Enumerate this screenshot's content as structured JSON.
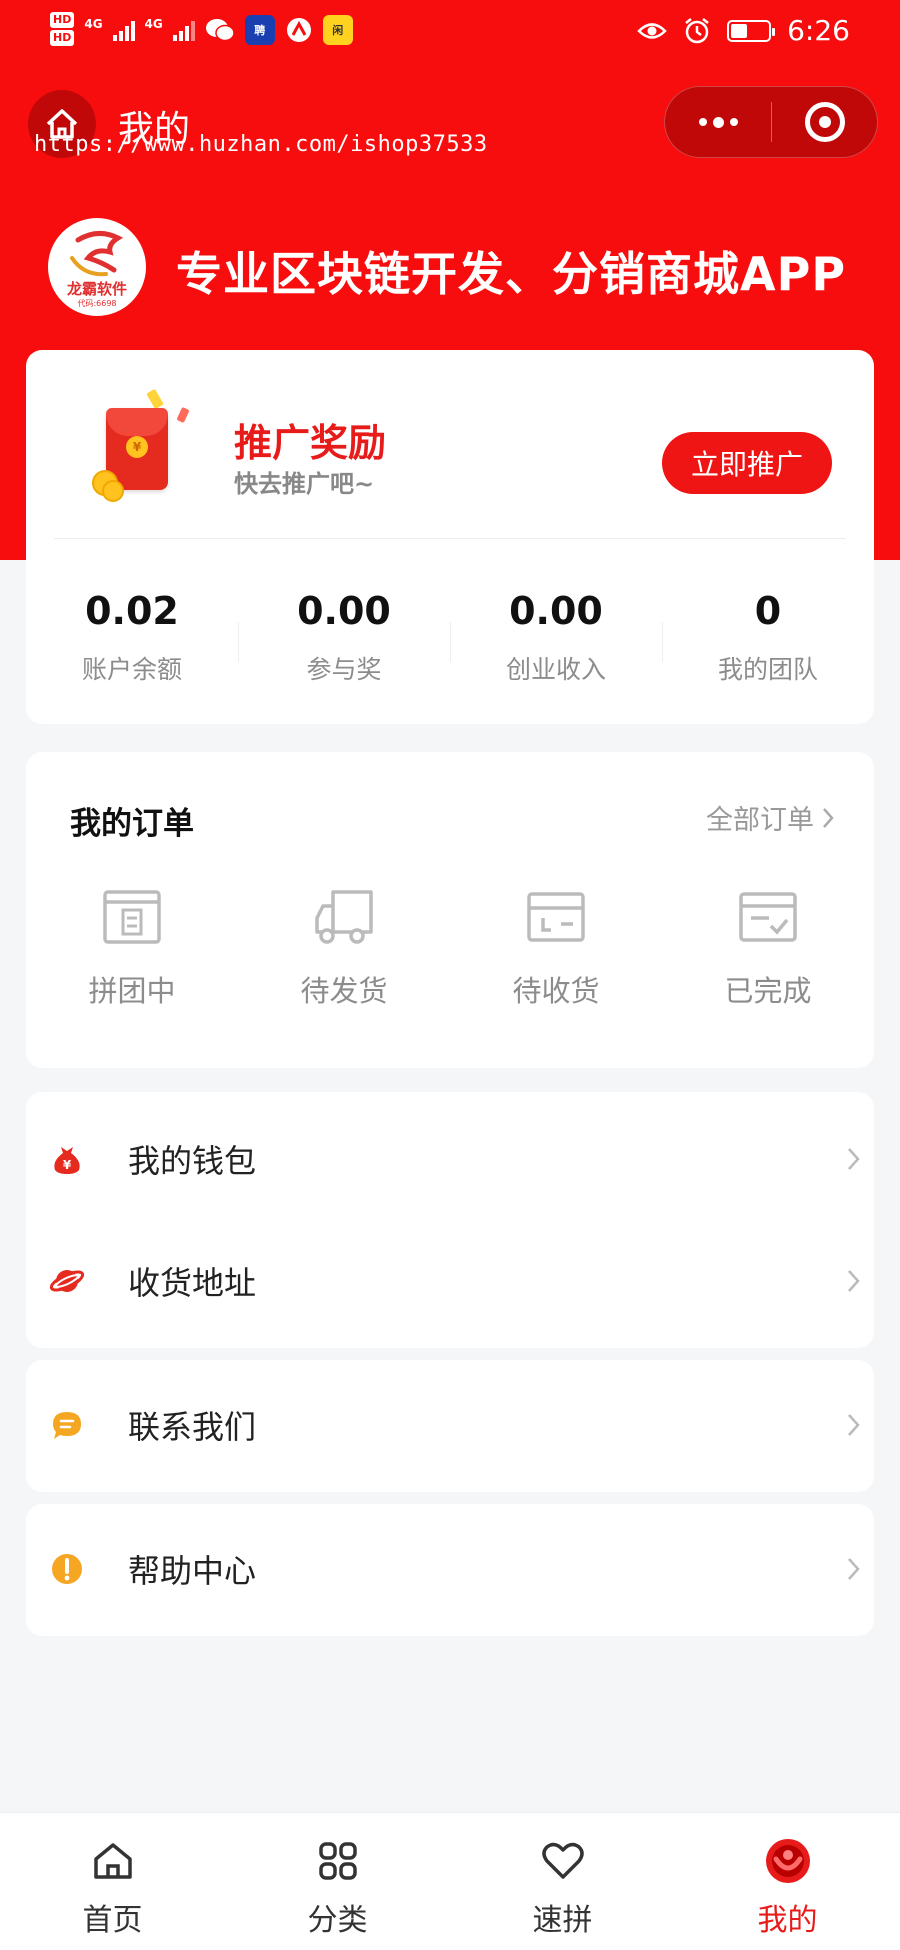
{
  "status_bar": {
    "hd1": "HD",
    "hd2": "HD",
    "net1": "4G",
    "net2": "4G",
    "badge1": "聘",
    "badge2": "闲",
    "time": "6:26"
  },
  "nav": {
    "title": "我的"
  },
  "watermark": "https://www.huzhan.com/ishop37533",
  "brand": {
    "logo_text": "龙霸软件",
    "logo_sub": "代码:6698",
    "tagline": "专业区块链开发、分销商城APP"
  },
  "promo": {
    "title": "推广奖励",
    "subtitle": "快去推广吧~",
    "button": "立即推广",
    "yuan_symbol": "¥",
    "stats": [
      {
        "value": "0.02",
        "label": "账户余额"
      },
      {
        "value": "0.00",
        "label": "参与奖"
      },
      {
        "value": "0.00",
        "label": "创业收入"
      },
      {
        "value": "0",
        "label": "我的团队"
      }
    ]
  },
  "orders": {
    "title": "我的订单",
    "all_link": "全部订单",
    "items": [
      {
        "label": "拼团中",
        "icon": "box-list-icon"
      },
      {
        "label": "待发货",
        "icon": "truck-icon"
      },
      {
        "label": "待收货",
        "icon": "package-icon"
      },
      {
        "label": "已完成",
        "icon": "box-check-icon"
      }
    ]
  },
  "menu": [
    {
      "label": "我的钱包",
      "icon": "money-bag-icon",
      "color": "#e52a1f"
    },
    {
      "label": "收货地址",
      "icon": "planet-icon",
      "color": "#e52a1f"
    },
    {
      "label": "联系我们",
      "icon": "chat-bubble-icon",
      "color": "#f5a623"
    },
    {
      "label": "帮助中心",
      "icon": "exclamation-icon",
      "color": "#f5a623"
    }
  ],
  "tabbar": {
    "items": [
      {
        "label": "首页",
        "icon": "home-icon"
      },
      {
        "label": "分类",
        "icon": "grid-icon"
      },
      {
        "label": "速拼",
        "icon": "heart-icon"
      },
      {
        "label": "我的",
        "icon": "profile-icon"
      }
    ],
    "active_index": 3
  },
  "colors": {
    "primary": "#f70d0d",
    "accent_red": "#e81b1b",
    "orange": "#f5a623",
    "page_bg": "#f5f6f7"
  }
}
